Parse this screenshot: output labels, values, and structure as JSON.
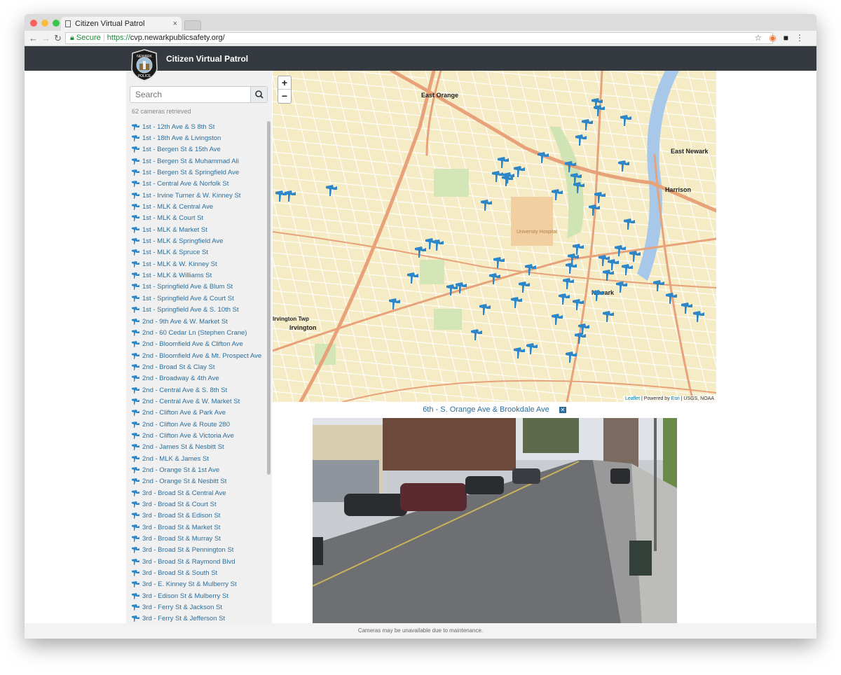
{
  "browser": {
    "tab_title": "Citizen Virtual Patrol",
    "secure_label": "Secure",
    "url_scheme": "https://",
    "url_host": "cvp.newarkpublicsafety.org",
    "url_path": "/"
  },
  "header": {
    "brand": "Citizen Virtual Patrol",
    "logo_text": "NEWARK POLICE"
  },
  "sidebar": {
    "search_placeholder": "Search",
    "count_text": "62 cameras retrieved",
    "items": [
      "1st - 12th Ave & S 8th St",
      "1st - 18th Ave & Livingston",
      "1st - Bergen St & 15th Ave",
      "1st - Bergen St & Muhammad Ali",
      "1st - Bergen St & Springfield Ave",
      "1st - Central Ave & Norfolk St",
      "1st - Irvine Turner & W. Kinney St",
      "1st - MLK & Central Ave",
      "1st - MLK & Court St",
      "1st - MLK & Market St",
      "1st - MLK & Springfield Ave",
      "1st - MLK & Spruce St",
      "1st - MLK & W. Kinney St",
      "1st - MLK & Williams St",
      "1st - Springfield Ave & Blum St",
      "1st - Springfield Ave & Court St",
      "1st - Springfield Ave & S. 10th St",
      "2nd - 9th Ave & W. Market St",
      "2nd - 60 Cedar Ln (Stephen Crane)",
      "2nd - Bloomfield Ave & Clifton Ave",
      "2nd - Bloomfield Ave & Mt. Prospect Ave",
      "2nd - Broad St & Clay St",
      "2nd - Broadway & 4th Ave",
      "2nd - Central Ave & S. 8th St",
      "2nd - Central Ave & W. Market St",
      "2nd - Clifton Ave & Park Ave",
      "2nd - Clifton Ave & Route 280",
      "2nd - Clifton Ave & Victoria Ave",
      "2nd - James St & Nesbitt St",
      "2nd - MLK & James St",
      "2nd - Orange St & 1st Ave",
      "2nd - Orange St & Nesbitt St",
      "3rd - Broad St & Central Ave",
      "3rd - Broad St & Court St",
      "3rd - Broad St & Edison St",
      "3rd - Broad St & Market St",
      "3rd - Broad St & Murray St",
      "3rd - Broad St & Pennington St",
      "3rd - Broad St & Raymond Blvd",
      "3rd - Broad St & South St",
      "3rd - E. Kinney St & Mulberry St",
      "3rd - Edison St & Mulberry St",
      "3rd - Ferry St & Jackson St",
      "3rd - Ferry St & Jefferson St"
    ]
  },
  "map": {
    "zoom_in": "+",
    "zoom_out": "−",
    "attribution_leaflet": "Leaflet",
    "attribution_mid": " | Powered by ",
    "attribution_esri": "Esri",
    "attribution_end": " | USGS, NOAA",
    "labels": {
      "east_orange": "East Orange",
      "east_newark": "East Newark",
      "harrison": "Harrison",
      "newark": "Newark",
      "irvington": "Irvington",
      "irvington_twp": "Irvington Twp",
      "hospital": "University Hospital"
    },
    "marker_color": "#2d86c8"
  },
  "camera": {
    "title": "6th - S. Orange Ave & Brookdale Ave",
    "close_icon": "close-icon"
  },
  "footer": {
    "text": "Cameras may be unavailable due to maintenance."
  }
}
